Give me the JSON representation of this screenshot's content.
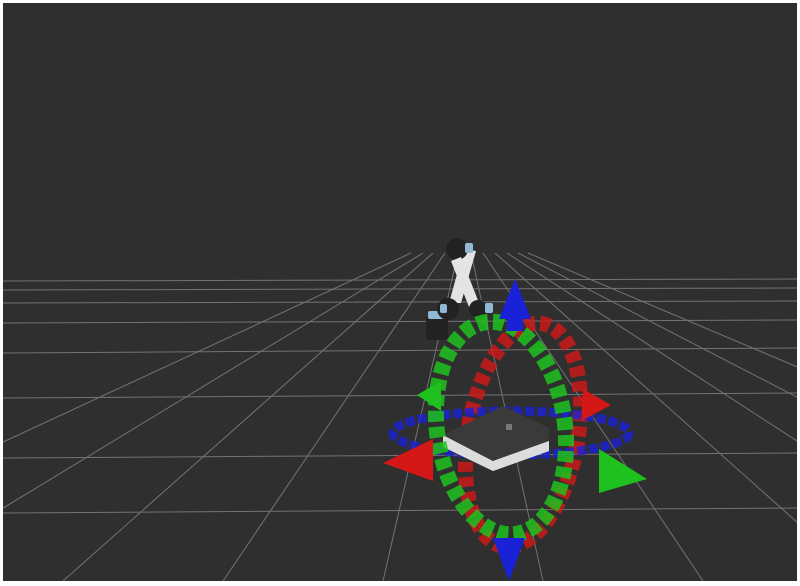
{
  "scene": {
    "background_color": "#2f2f2f",
    "grid_color": "#8a8a8a",
    "robot": {
      "link_color": "#e4e4e4",
      "joint_color": "#222222",
      "joint_accent_color": "#8fb9d6"
    },
    "target_object": {
      "top_color": "#3a3a3a",
      "side_color": "#dcdcdc"
    },
    "interactive_marker": {
      "x_axis_color": "#d41818",
      "y_axis_color": "#1fc11f",
      "z_axis_color": "#1a22d8"
    }
  }
}
